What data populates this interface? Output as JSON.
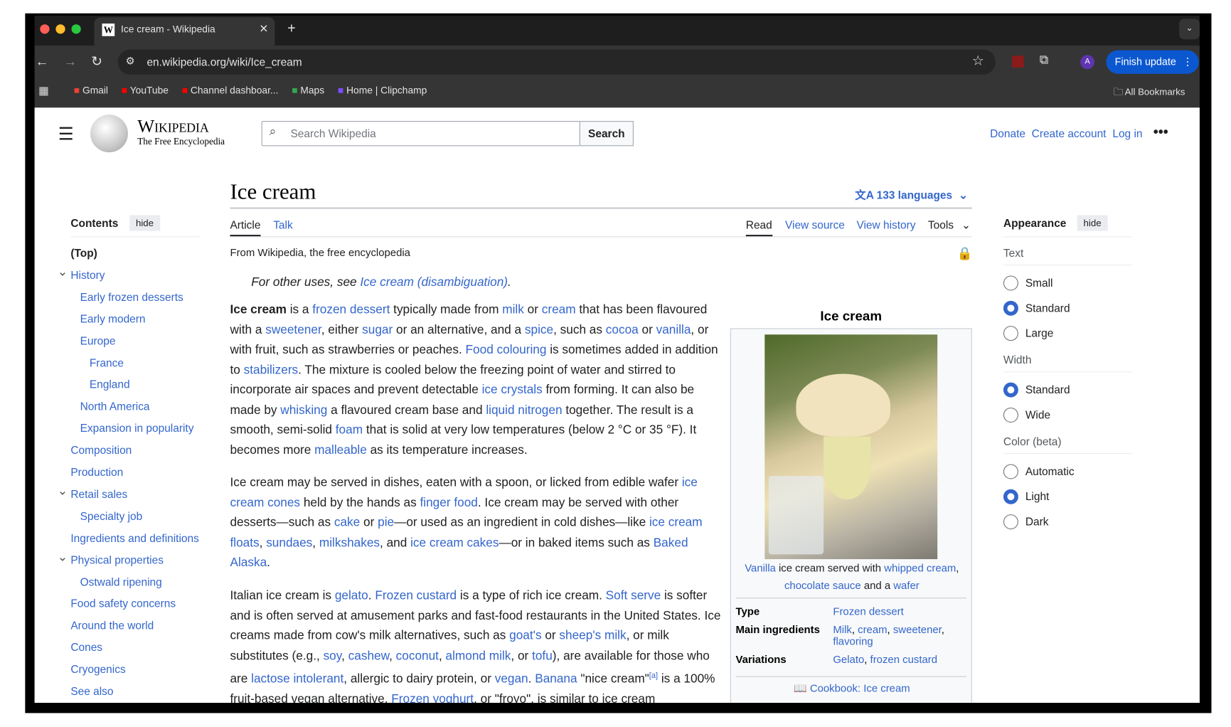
{
  "browser": {
    "tab_title": "Ice cream - Wikipedia",
    "tab_favicon": "W",
    "url": "en.wikipedia.org/wiki/Ice_cream",
    "profile_initial": "A",
    "finish_update": "Finish update",
    "bookmarks": [
      {
        "label": "Gmail",
        "icon": "gmail-icon",
        "color": "#ea4335"
      },
      {
        "label": "YouTube",
        "icon": "youtube-icon",
        "color": "#ff0000"
      },
      {
        "label": "Channel dashboar...",
        "icon": "youtube-icon",
        "color": "#ff0000"
      },
      {
        "label": "Maps",
        "icon": "maps-pin-icon",
        "color": "#34a853"
      },
      {
        "label": "Home | Clipchamp",
        "icon": "clipchamp-icon",
        "color": "#7c4dff"
      }
    ],
    "all_bookmarks": "All Bookmarks"
  },
  "header": {
    "wordmark": "Wikipedia",
    "tagline": "The Free Encyclopedia",
    "search_placeholder": "Search Wikipedia",
    "search_button": "Search",
    "links": [
      "Donate",
      "Create account",
      "Log in"
    ]
  },
  "article": {
    "title": "Ice cream",
    "languages": "133 languages",
    "tabs_left": [
      "Article",
      "Talk"
    ],
    "tabs_right": [
      "Read",
      "View source",
      "View history",
      "Tools"
    ],
    "tagline": "From Wikipedia, the free encyclopedia",
    "hatnote": [
      {
        "t": "For other uses, see "
      },
      {
        "t": "Ice cream (disambiguation)",
        "l": 1
      },
      {
        "t": "."
      }
    ],
    "paragraphs": [
      [
        {
          "t": "Ice cream",
          "b": 1
        },
        {
          "t": " is a "
        },
        {
          "t": "frozen dessert",
          "l": 1
        },
        {
          "t": " typically made from "
        },
        {
          "t": "milk",
          "l": 1
        },
        {
          "t": " or "
        },
        {
          "t": "cream",
          "l": 1
        },
        {
          "t": " that has been flavoured with a "
        },
        {
          "t": "sweetener",
          "l": 1
        },
        {
          "t": ", either "
        },
        {
          "t": "sugar",
          "l": 1
        },
        {
          "t": " or an alternative, and a "
        },
        {
          "t": "spice",
          "l": 1
        },
        {
          "t": ", such as "
        },
        {
          "t": "cocoa",
          "l": 1
        },
        {
          "t": " or "
        },
        {
          "t": "vanilla",
          "l": 1
        },
        {
          "t": ", or with fruit, such as strawberries or peaches. "
        },
        {
          "t": "Food colouring",
          "l": 1
        },
        {
          "t": " is sometimes added in addition to "
        },
        {
          "t": "stabilizers",
          "l": 1
        },
        {
          "t": ". The mixture is cooled below the freezing point of water and stirred to incorporate air spaces and prevent detectable "
        },
        {
          "t": "ice crystals",
          "l": 1
        },
        {
          "t": " from forming. It can also be made by "
        },
        {
          "t": "whisking",
          "l": 1
        },
        {
          "t": " a flavoured cream base and "
        },
        {
          "t": "liquid nitrogen",
          "l": 1
        },
        {
          "t": " together. The result is a smooth, semi-solid "
        },
        {
          "t": "foam",
          "l": 1
        },
        {
          "t": " that is solid at very low temperatures (below 2 °C or 35 °F). It becomes more "
        },
        {
          "t": "malleable",
          "l": 1
        },
        {
          "t": " as its temperature increases."
        }
      ],
      [
        {
          "t": "Ice cream may be served in dishes, eaten with a spoon, or licked from edible wafer "
        },
        {
          "t": "ice cream cones",
          "l": 1
        },
        {
          "t": " held by the hands as "
        },
        {
          "t": "finger food",
          "l": 1
        },
        {
          "t": ". Ice cream may be served with other desserts—such as "
        },
        {
          "t": "cake",
          "l": 1
        },
        {
          "t": " or "
        },
        {
          "t": "pie",
          "l": 1
        },
        {
          "t": "—or used as an ingredient in cold dishes—like "
        },
        {
          "t": "ice cream floats",
          "l": 1
        },
        {
          "t": ", "
        },
        {
          "t": "sundaes",
          "l": 1
        },
        {
          "t": ", "
        },
        {
          "t": "milkshakes",
          "l": 1
        },
        {
          "t": ", and "
        },
        {
          "t": "ice cream cakes",
          "l": 1
        },
        {
          "t": "—or in baked items such as "
        },
        {
          "t": "Baked Alaska",
          "l": 1
        },
        {
          "t": "."
        }
      ],
      [
        {
          "t": "Italian ice cream is "
        },
        {
          "t": "gelato",
          "l": 1
        },
        {
          "t": ". "
        },
        {
          "t": "Frozen custard",
          "l": 1
        },
        {
          "t": " is a type of rich ice cream. "
        },
        {
          "t": "Soft serve",
          "l": 1
        },
        {
          "t": " is softer and is often served at amusement parks and fast-food restaurants in the United States. Ice creams made from cow's milk alternatives, such as "
        },
        {
          "t": "goat's",
          "l": 1
        },
        {
          "t": " or "
        },
        {
          "t": "sheep's milk",
          "l": 1
        },
        {
          "t": ", or milk substitutes (e.g., "
        },
        {
          "t": "soy",
          "l": 1
        },
        {
          "t": ", "
        },
        {
          "t": "cashew",
          "l": 1
        },
        {
          "t": ", "
        },
        {
          "t": "coconut",
          "l": 1
        },
        {
          "t": ", "
        },
        {
          "t": "almond milk",
          "l": 1
        },
        {
          "t": ", or "
        },
        {
          "t": "tofu",
          "l": 1
        },
        {
          "t": "), are available for those who are "
        },
        {
          "t": "lactose intolerant",
          "l": 1
        },
        {
          "t": ", allergic to dairy protein, or "
        },
        {
          "t": "vegan",
          "l": 1
        },
        {
          "t": ". "
        },
        {
          "t": "Banana",
          "l": 1
        },
        {
          "t": " \"nice cream\""
        },
        {
          "t": "[a]",
          "l": 1,
          "sup": 1
        },
        {
          "t": " is a 100% fruit-based vegan alternative. "
        },
        {
          "t": "Frozen yoghurt",
          "l": 1
        },
        {
          "t": ", or \"froyo\", is similar to ice cream"
        }
      ]
    ]
  },
  "toc": {
    "title": "Contents",
    "hide": "hide",
    "items": [
      {
        "label": "(Top)",
        "level": 1,
        "bold": 1
      },
      {
        "label": "History",
        "level": 1,
        "chev": 1
      },
      {
        "label": "Early frozen desserts",
        "level": 2
      },
      {
        "label": "Early modern",
        "level": 2
      },
      {
        "label": "Europe",
        "level": 2
      },
      {
        "label": "France",
        "level": 3
      },
      {
        "label": "England",
        "level": 3
      },
      {
        "label": "North America",
        "level": 2
      },
      {
        "label": "Expansion in popularity",
        "level": 2
      },
      {
        "label": "Composition",
        "level": 1
      },
      {
        "label": "Production",
        "level": 1
      },
      {
        "label": "Retail sales",
        "level": 1,
        "chev": 1
      },
      {
        "label": "Specialty job",
        "level": 2
      },
      {
        "label": "Ingredients and definitions",
        "level": 1
      },
      {
        "label": "Physical properties",
        "level": 1,
        "chev": 1
      },
      {
        "label": "Ostwald ripening",
        "level": 2
      },
      {
        "label": "Food safety concerns",
        "level": 1
      },
      {
        "label": "Around the world",
        "level": 1
      },
      {
        "label": "Cones",
        "level": 1
      },
      {
        "label": "Cryogenics",
        "level": 1
      },
      {
        "label": "See also",
        "level": 1
      }
    ]
  },
  "infobox": {
    "title": "Ice cream",
    "caption": [
      {
        "t": "Vanilla",
        "l": 1
      },
      {
        "t": " ice cream served with "
      },
      {
        "t": "whipped cream",
        "l": 1
      },
      {
        "t": ", "
      },
      {
        "t": "chocolate sauce",
        "l": 1
      },
      {
        "t": " and a "
      },
      {
        "t": "wafer",
        "l": 1
      }
    ],
    "rows": [
      {
        "label": "Type",
        "value": [
          {
            "t": "Frozen dessert",
            "l": 1
          }
        ]
      },
      {
        "label": "Main ingredients",
        "value": [
          {
            "t": "Milk",
            "l": 1
          },
          {
            "t": ", "
          },
          {
            "t": "cream",
            "l": 1
          },
          {
            "t": ", "
          },
          {
            "t": "sweetener",
            "l": 1
          },
          {
            "t": ", "
          },
          {
            "t": "flavoring",
            "l": 1
          }
        ]
      },
      {
        "label": "Variations",
        "value": [
          {
            "t": "Gelato",
            "l": 1
          },
          {
            "t": ", "
          },
          {
            "t": "frozen custard",
            "l": 1
          }
        ]
      }
    ],
    "cookbook": "Cookbook: Ice cream"
  },
  "appearance": {
    "title": "Appearance",
    "hide": "hide",
    "groups": [
      {
        "label": "Text",
        "options": [
          "Small",
          "Standard",
          "Large"
        ],
        "selected": "Standard"
      },
      {
        "label": "Width",
        "options": [
          "Standard",
          "Wide"
        ],
        "selected": "Standard"
      },
      {
        "label": "Color (beta)",
        "options": [
          "Automatic",
          "Light",
          "Dark"
        ],
        "selected": "Light"
      }
    ]
  },
  "colors": {
    "link": "#3366cc",
    "accent": "#3366cc",
    "chrome_update": "#0b57d0"
  }
}
